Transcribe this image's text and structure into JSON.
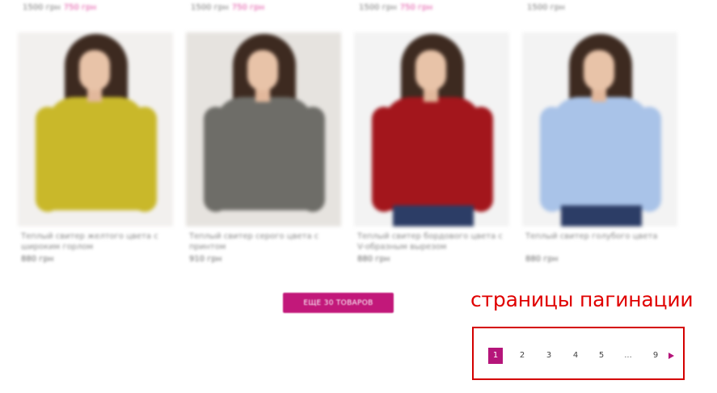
{
  "top_row": [
    {
      "old_price": "1500 грн",
      "new_price": "750 грн"
    },
    {
      "old_price": "1500 грн",
      "new_price": "750 грн"
    },
    {
      "old_price": "1500 грн",
      "new_price": "750 грн"
    },
    {
      "old_price": "1500 грн",
      "new_price": ""
    }
  ],
  "products": [
    {
      "title": "Теплый свитер желтого цвета с широким горлом",
      "price": "880 грн",
      "color": "#c9b82a",
      "backdrop": "#f2f0ee"
    },
    {
      "title": "Теплый свитер серого цвета с принтом",
      "price": "910 грн",
      "color": "#6e6d68",
      "backdrop": "#e6e3df"
    },
    {
      "title": "Теплый свитер бордового цвета с V-образным вырезом",
      "price": "880 грн",
      "color": "#a3161c",
      "backdrop": "#f3f3f3"
    },
    {
      "title": "Теплый свитер голубого цвета",
      "price": "880 грн",
      "color": "#a9c3e8",
      "backdrop": "#f3f3f3"
    }
  ],
  "more_button": {
    "label": "Еще 30 товаров"
  },
  "annotation": {
    "label": "страницы пагинации",
    "color": "#e00000"
  },
  "pagination": {
    "pages": [
      "1",
      "2",
      "3",
      "4",
      "5",
      "...",
      "9"
    ],
    "active": "1",
    "accent": "#b5157a"
  }
}
